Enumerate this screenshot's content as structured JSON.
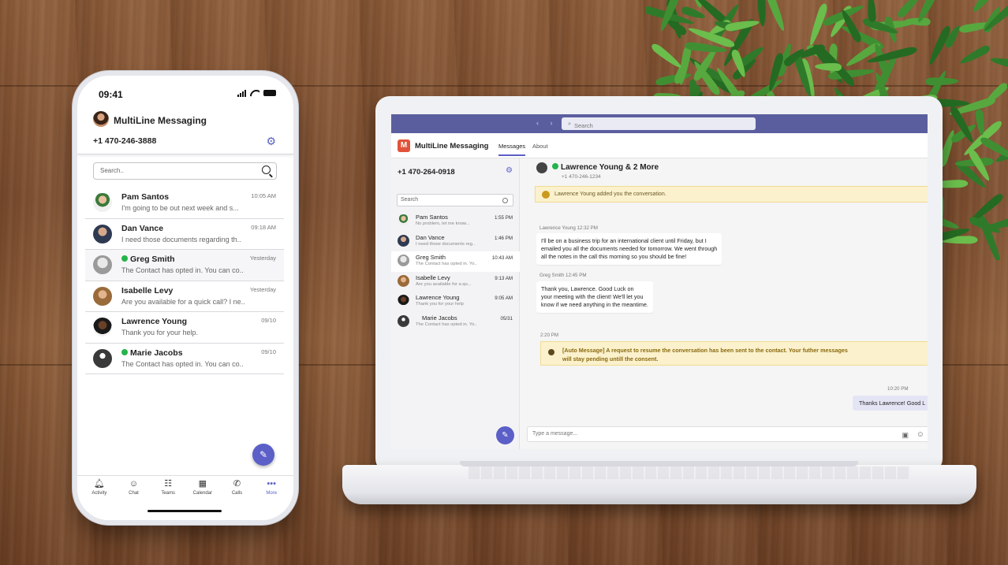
{
  "phone": {
    "time": "09:41",
    "app_name": "MultiLine Messaging",
    "number": "+1 470-246-3888",
    "search_placeholder": "Search..",
    "conversations": [
      {
        "name": "Pam Santos",
        "time": "10:05 AM",
        "preview": "I'm going to be out next week and s...",
        "whatsapp": false
      },
      {
        "name": "Dan Vance",
        "time": "09:18 AM",
        "preview": "I need those documents regarding th..",
        "whatsapp": false
      },
      {
        "name": "Greg Smith",
        "time": "Yesterday",
        "preview": "The Contact has opted in. You can co..",
        "whatsapp": true
      },
      {
        "name": "Isabelle Levy",
        "time": "Yesterday",
        "preview": "Are you available for a quick call? I ne..",
        "whatsapp": false
      },
      {
        "name": "Lawrence Young",
        "time": "09/10",
        "preview": "Thank you for your help.",
        "whatsapp": false
      },
      {
        "name": "Marie Jacobs",
        "time": "09/10",
        "preview": "The Contact has opted in. You can co..",
        "whatsapp": true
      }
    ],
    "tabs": [
      {
        "label": "Activity",
        "icon": "bell-icon"
      },
      {
        "label": "Chat",
        "icon": "chat-icon"
      },
      {
        "label": "Teams",
        "icon": "teams-icon"
      },
      {
        "label": "Calendar",
        "icon": "calendar-icon"
      },
      {
        "label": "Calls",
        "icon": "phone-icon"
      },
      {
        "label": "More",
        "icon": "more-icon"
      }
    ]
  },
  "desktop": {
    "search_placeholder": "Search",
    "app_name": "MultiLine Messaging",
    "tabs": [
      "Messages",
      "About"
    ],
    "number": "+1 470-264-0918",
    "list_search_placeholder": "Search",
    "conversations": [
      {
        "name": "Pam Santos",
        "preview": "No problem, let me know...",
        "time": "1:55 PM"
      },
      {
        "name": "Dan Vance",
        "preview": "I need those documents reg..",
        "time": "1:46 PM"
      },
      {
        "name": "Greg Smith",
        "preview": "The Contact has opted in. Yo..",
        "time": "10:43 AM"
      },
      {
        "name": "Isabelle Levy",
        "preview": "Are you available for a qu...",
        "time": "9:13 AM"
      },
      {
        "name": "Lawrence Young",
        "preview": "Thank you for your help",
        "time": "9:05 AM"
      },
      {
        "name": "Marie Jacobs",
        "preview": "The Contact has opted in. Yo..",
        "time": "05/31"
      }
    ],
    "chat": {
      "title": "Lawrence Young & 2 More",
      "subtitle": "+1 470-246-1234",
      "banner": "Lawrence Young added you the conversation.",
      "msg1_meta": "Lawrence Young  12:32 PM",
      "msg1_lines": [
        "I'll be on a business trip for an international client until Friday, but I",
        " emailed you all the documents needed for tomorrow. We went through",
        "all the notes in the call this morning so you should be fine!"
      ],
      "msg2_meta": "Greg Smith  12:45 PM",
      "msg2_lines": [
        "Thank you, Lawrence. Good Luck on",
        "your meeting with the client! We'll let you",
        "know if we need anything in the meantime."
      ],
      "auto_time": "2:20 PM",
      "auto_line1": "[Auto Message] A request to resume the conversation has been sent to the contact. Your futher messages",
      "auto_line2": "will stay pending untill the consent.",
      "mine_time": "10:20 PM",
      "mine_text": "Thanks Lawrence! Good L",
      "input_placeholder": "Type a message..."
    }
  },
  "colors": {
    "accent": "#5b5fc7",
    "teams_bar": "#5b5e9e",
    "whatsapp": "#25b34b",
    "notice_bg": "#fbf1cc"
  }
}
